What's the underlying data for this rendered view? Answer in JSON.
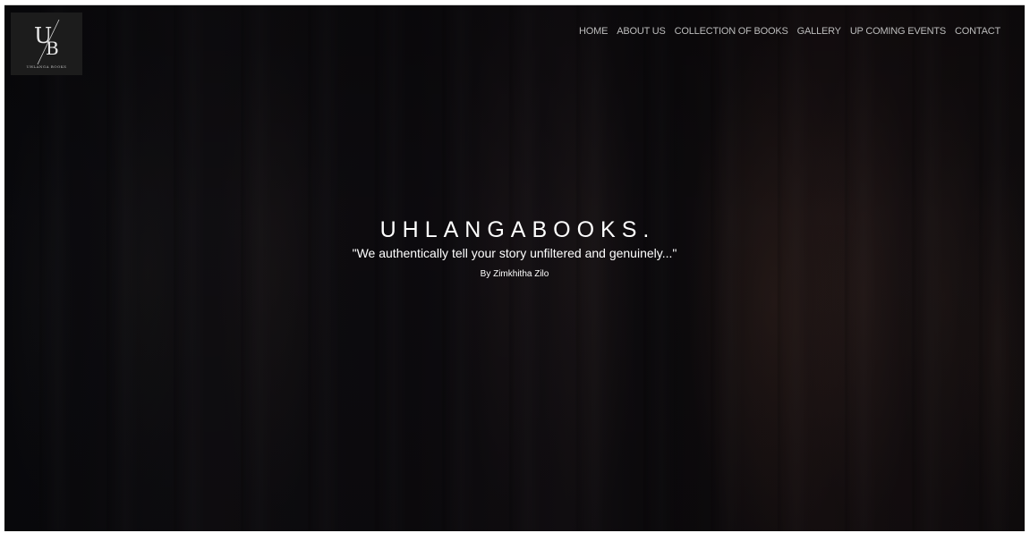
{
  "logo": {
    "monogram_u": "U",
    "monogram_b": "B",
    "caption": "UHLANGA BOOKS"
  },
  "nav": {
    "items": [
      "HOME",
      "ABOUT US",
      "COLLECTION OF BOOKS",
      "GALLERY",
      "UP COMING EVENTS",
      "CONTACT"
    ]
  },
  "hero": {
    "title": "UHLANGABOOKS.",
    "tagline": "\"We authentically tell your story unfiltered and genuinely...\"",
    "author": "By Zimkhitha Zilo"
  },
  "colors": {
    "background": "#0b0b10",
    "nav_text": "#bcbcbc",
    "hero_text": "#ffffff",
    "logo_bg": "#1c1c1c"
  }
}
